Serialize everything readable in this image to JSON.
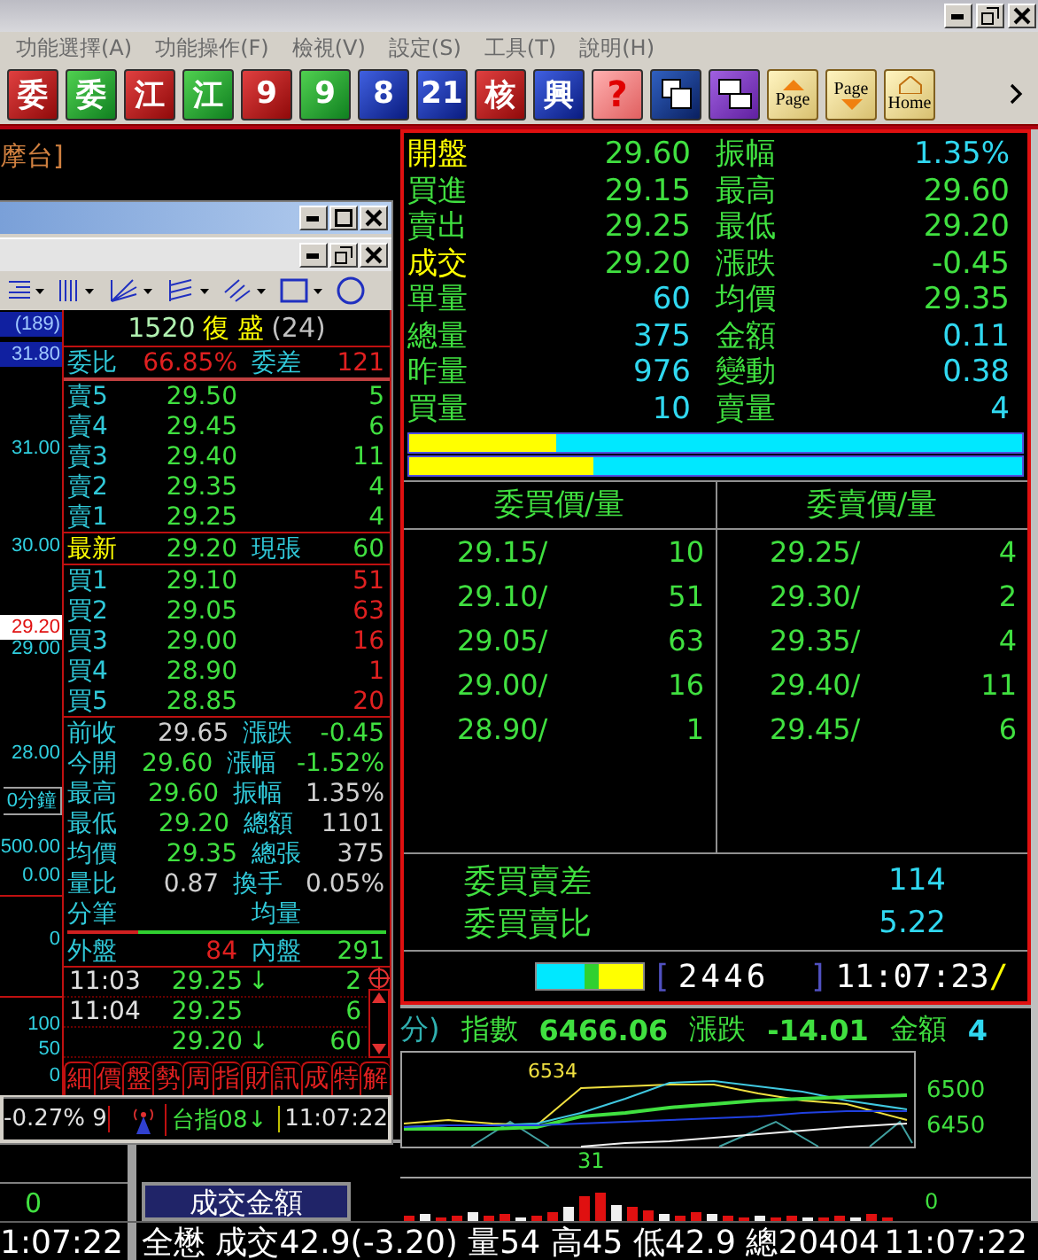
{
  "menu": [
    "功能選擇(A)",
    "功能操作(F)",
    "檢視(V)",
    "設定(S)",
    "工具(T)",
    "說明(H)"
  ],
  "toolbar": [
    {
      "kind": "red",
      "label": "委"
    },
    {
      "kind": "green",
      "label": "委"
    },
    {
      "kind": "red",
      "label": "江"
    },
    {
      "kind": "green",
      "label": "江"
    },
    {
      "kind": "red",
      "label": "9"
    },
    {
      "kind": "green",
      "label": "9"
    },
    {
      "kind": "blue",
      "label": "8"
    },
    {
      "kind": "blue",
      "label": "21"
    },
    {
      "kind": "red",
      "label": "核"
    },
    {
      "kind": "blue",
      "label": "興"
    },
    {
      "kind": "pink",
      "label": "?"
    },
    {
      "kind": "windows"
    },
    {
      "kind": "swap"
    },
    {
      "kind": "page-up",
      "label": "Page"
    },
    {
      "kind": "page-down",
      "label": "Page"
    },
    {
      "kind": "home",
      "label": "Home"
    }
  ],
  "background": {
    "title_fragment": "摩台]",
    "volume_value": "0",
    "amount_button": "成交金額"
  },
  "quote_window": {
    "axis": [
      {
        "label": "(189)",
        "kind": "header"
      },
      {
        "label": "31.80",
        "kind": "header"
      },
      {
        "label": "31.00",
        "kind": "price"
      },
      {
        "label": "30.00",
        "kind": "price"
      },
      {
        "label": "29.20",
        "kind": "current"
      },
      {
        "label": "29.00",
        "kind": "price"
      },
      {
        "label": "28.00",
        "kind": "price"
      },
      {
        "label": "0分鐘",
        "kind": "period"
      },
      {
        "label": "500.00",
        "kind": "price"
      },
      {
        "label": "0.00",
        "kind": "price"
      },
      {
        "label": "0",
        "kind": "price"
      },
      {
        "label": "100",
        "kind": "price"
      },
      {
        "label": "50",
        "kind": "price"
      },
      {
        "label": "0",
        "kind": "price"
      }
    ],
    "stock": {
      "code": "1520",
      "name": "復 盛",
      "count": "(24)"
    },
    "ratio": {
      "label": "委比",
      "value": "66.85%",
      "diff_label": "委差",
      "diff": "121"
    },
    "asks": [
      {
        "label": "賣5",
        "price": "29.50",
        "qty": "5"
      },
      {
        "label": "賣4",
        "price": "29.45",
        "qty": "6"
      },
      {
        "label": "賣3",
        "price": "29.40",
        "qty": "11"
      },
      {
        "label": "賣2",
        "price": "29.35",
        "qty": "4"
      },
      {
        "label": "賣1",
        "price": "29.25",
        "qty": "4"
      }
    ],
    "last": {
      "label": "最新",
      "price": "29.20",
      "qty_label": "現張",
      "qty": "60"
    },
    "bids": [
      {
        "label": "買1",
        "price": "29.10",
        "qty": "51"
      },
      {
        "label": "買2",
        "price": "29.05",
        "qty": "63"
      },
      {
        "label": "買3",
        "price": "29.00",
        "qty": "16"
      },
      {
        "label": "買4",
        "price": "28.90",
        "qty": "1"
      },
      {
        "label": "買5",
        "price": "28.85",
        "qty": "20"
      }
    ],
    "stats": [
      {
        "label": "前收",
        "value": "29.65",
        "muted": true,
        "label2": "漲跌",
        "value2": "-0.45",
        "muted2": false
      },
      {
        "label": "今開",
        "value": "29.60",
        "muted": false,
        "label2": "漲幅",
        "value2": "-1.52%",
        "muted2": false
      },
      {
        "label": "最高",
        "value": "29.60",
        "muted": false,
        "label2": "振幅",
        "value2": "1.35%",
        "muted2": true
      },
      {
        "label": "最低",
        "value": "29.20",
        "muted": false,
        "label2": "總額",
        "value2": "1101",
        "muted2": true
      },
      {
        "label": "均價",
        "value": "29.35",
        "muted": false,
        "label2": "總張",
        "value2": "375",
        "muted2": true
      },
      {
        "label": "量比",
        "value": "0.87",
        "muted": true,
        "label2": "換手",
        "value2": "0.05%",
        "muted2": true
      },
      {
        "label": "分筆",
        "label2": "均量"
      }
    ],
    "flow": {
      "outer_label": "外盤",
      "outer": "84",
      "inner_label": "內盤",
      "inner": "291",
      "level": 0.22
    },
    "ticks": [
      {
        "time": "11:03",
        "price": "29.25",
        "arrow": "↓",
        "qty": "2"
      },
      {
        "time": "11:04",
        "price": "29.25",
        "qty": "6"
      },
      {
        "price": "29.20",
        "arrow": "↓",
        "qty": "60"
      }
    ],
    "tabs": [
      "細",
      "價",
      "盤",
      "勢",
      "周",
      "指",
      "財",
      "訊",
      "成",
      "特",
      "解"
    ],
    "status": {
      "change": "-0.27% 9",
      "index": "台指08↓",
      "time": "11:07:22"
    }
  },
  "quote": {
    "rows": [
      {
        "label": "開盤",
        "highlighted": true,
        "value": "29.60",
        "value_volume": false,
        "label2": "振幅",
        "value2": "1.35%",
        "value2_volume": true
      },
      {
        "label": "買進",
        "highlighted": false,
        "value": "29.15",
        "value_volume": false,
        "label2": "最高",
        "value2": "29.60",
        "value2_volume": false
      },
      {
        "label": "賣出",
        "highlighted": false,
        "value": "29.25",
        "value_volume": false,
        "label2": "最低",
        "value2": "29.20",
        "value2_volume": false
      },
      {
        "label": "成交",
        "highlighted": true,
        "value": "29.20",
        "value_volume": false,
        "label2": "漲跌",
        "value2": "-0.45",
        "value2_volume": false
      },
      {
        "label": "單量",
        "highlighted": false,
        "value": "60",
        "value_volume": true,
        "label2": "均價",
        "value2": "29.35",
        "value2_volume": false
      },
      {
        "label": "總量",
        "highlighted": false,
        "value": "375",
        "value_volume": true,
        "label2": "金額",
        "value2": "0.11",
        "value2_volume": true
      },
      {
        "label": "昨量",
        "highlighted": false,
        "value": "976",
        "value_volume": true,
        "label2": "變動",
        "value2": "0.38",
        "value2_volume": true
      },
      {
        "label": "買量",
        "highlighted": false,
        "value": "10",
        "value_volume": true,
        "label2": "賣量",
        "value2": "4",
        "value2_volume": true
      }
    ],
    "bars": [
      {
        "level": 0.24
      },
      {
        "level": 0.3
      }
    ],
    "book": {
      "bid_header": "委買價/量",
      "ask_header": "委賣價/量",
      "rows": [
        {
          "bid_price": "29.15/",
          "bid_qty": "10",
          "ask_price": "29.25/",
          "ask_qty": "4"
        },
        {
          "bid_price": "29.10/",
          "bid_qty": "51",
          "ask_price": "29.30/",
          "ask_qty": "2"
        },
        {
          "bid_price": "29.05/",
          "bid_qty": "63",
          "ask_price": "29.35/",
          "ask_qty": "4"
        },
        {
          "bid_price": "29.00/",
          "bid_qty": "16",
          "ask_price": "29.40/",
          "ask_qty": "11"
        },
        {
          "bid_price": "28.90/",
          "bid_qty": "1",
          "ask_price": "29.45/",
          "ask_qty": "6"
        }
      ]
    },
    "summary": [
      {
        "label": "委買賣差",
        "value": "114"
      },
      {
        "label": "委買賣比",
        "value": "5.22"
      }
    ],
    "footer": {
      "open_bracket": "[",
      "code": "2446",
      "close_bracket": "]",
      "time": "11:07:23",
      "spinner": "/"
    }
  },
  "index_panel": {
    "header": [
      {
        "text": "分)",
        "kind": "label"
      },
      {
        "text": "指數",
        "kind": "label"
      },
      {
        "text": "6466.06",
        "kind": "value"
      },
      {
        "text": "漲跌",
        "kind": "label"
      },
      {
        "text": "-14.01",
        "kind": "value"
      },
      {
        "text": "金額",
        "kind": "label"
      },
      {
        "text": "4",
        "kind": "accent"
      }
    ],
    "peak_label": "6534",
    "axis_labels": [
      "6500",
      "6450"
    ],
    "date_label": "31",
    "volume_axis": "0"
  },
  "status_bar": {
    "clock": "1:07:22",
    "ticker": "全懋 成交42.9(-3.20) 量54 高45 低42.9 總20404",
    "time": "11:07:22"
  }
}
